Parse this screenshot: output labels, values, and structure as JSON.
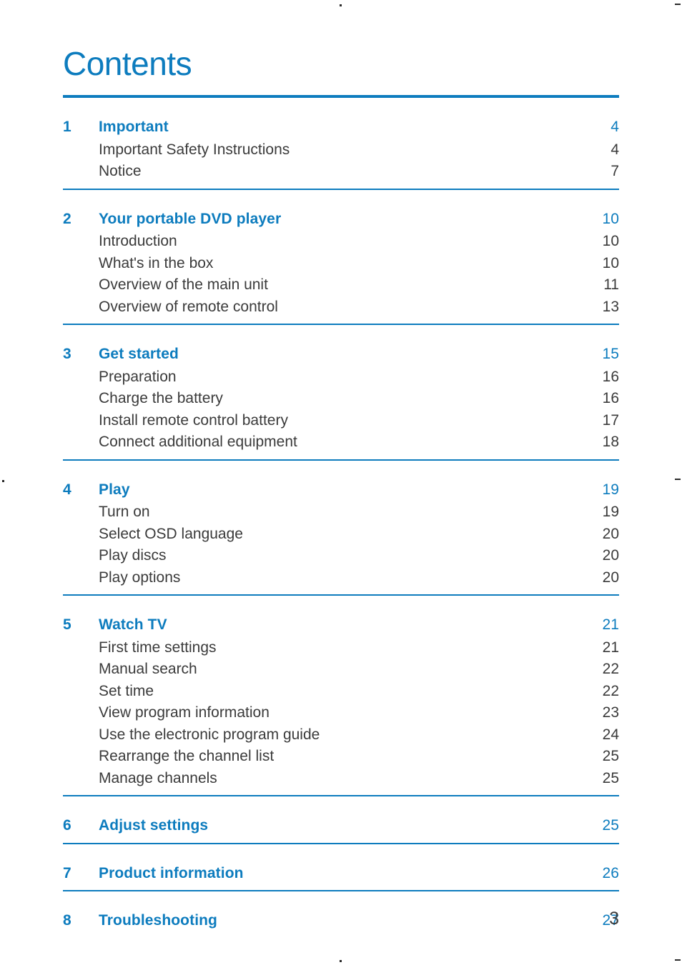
{
  "document": {
    "title": "Contents",
    "folio": "3",
    "accent_color": "#0d7cbe",
    "body_color": "#3b3b3b"
  },
  "toc": {
    "sections": [
      {
        "number": "1",
        "title": "Important",
        "page": "4",
        "items": [
          {
            "label": "Important Safety Instructions",
            "page": "4"
          },
          {
            "label": "Notice",
            "page": "7"
          }
        ]
      },
      {
        "number": "2",
        "title": "Your portable DVD player",
        "page": "10",
        "items": [
          {
            "label": "Introduction",
            "page": "10"
          },
          {
            "label": "What's in the box",
            "page": "10"
          },
          {
            "label": "Overview of the main unit",
            "page": "11"
          },
          {
            "label": "Overview of remote control",
            "page": "13"
          }
        ]
      },
      {
        "number": "3",
        "title": "Get started",
        "page": "15",
        "items": [
          {
            "label": "Preparation",
            "page": "16"
          },
          {
            "label": "Charge the battery",
            "page": "16"
          },
          {
            "label": "Install remote control battery",
            "page": "17"
          },
          {
            "label": "Connect additional equipment",
            "page": "18"
          }
        ]
      },
      {
        "number": "4",
        "title": "Play",
        "page": "19",
        "items": [
          {
            "label": "Turn on",
            "page": "19"
          },
          {
            "label": "Select OSD language",
            "page": "20"
          },
          {
            "label": "Play discs",
            "page": "20"
          },
          {
            "label": "Play options",
            "page": "20"
          }
        ]
      },
      {
        "number": "5",
        "title": "Watch TV",
        "page": "21",
        "items": [
          {
            "label": "First time settings",
            "page": "21"
          },
          {
            "label": "Manual search",
            "page": "22"
          },
          {
            "label": "Set time",
            "page": "22"
          },
          {
            "label": "View program information",
            "page": "23"
          },
          {
            "label": "Use the electronic program guide",
            "page": "24"
          },
          {
            "label": "Rearrange the channel list",
            "page": "25"
          },
          {
            "label": "Manage channels",
            "page": "25"
          }
        ]
      },
      {
        "number": "6",
        "title": "Adjust settings",
        "page": "25",
        "items": []
      },
      {
        "number": "7",
        "title": "Product information",
        "page": "26",
        "items": []
      },
      {
        "number": "8",
        "title": "Troubleshooting",
        "page": "27",
        "items": []
      }
    ]
  }
}
